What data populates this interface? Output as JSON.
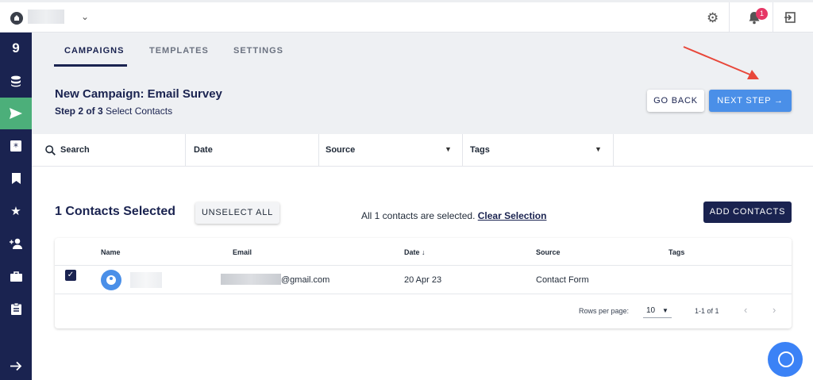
{
  "topbar": {
    "notification_count": "1"
  },
  "icons": {
    "home": "home-icon",
    "gear": "⚙",
    "bell": "🔔",
    "exit": "⇥"
  },
  "sidebar": {
    "items": [
      {
        "name": "logo",
        "glyph": "9"
      },
      {
        "name": "database",
        "glyph": "≋"
      },
      {
        "name": "send",
        "glyph": "➤",
        "active": true
      },
      {
        "name": "asterisk",
        "glyph": "✱"
      },
      {
        "name": "bookmark",
        "glyph": "▮"
      },
      {
        "name": "star",
        "glyph": "★"
      },
      {
        "name": "add-user",
        "glyph": "✚"
      },
      {
        "name": "briefcase",
        "glyph": "▬"
      },
      {
        "name": "clipboard",
        "glyph": "▤"
      },
      {
        "name": "expand",
        "glyph": "→"
      }
    ]
  },
  "tabs": [
    "CAMPAIGNS",
    "TEMPLATES",
    "SETTINGS"
  ],
  "header": {
    "title": "New Campaign: Email Survey",
    "step_bold": "Step 2 of 3",
    "step_text": " Select Contacts",
    "go_back_label": "GO BACK",
    "next_step_label": "NEXT STEP →"
  },
  "filters": {
    "search_label": "Search",
    "date_label": "Date",
    "source_label": "Source",
    "tags_label": "Tags"
  },
  "selection": {
    "title": "1 Contacts Selected",
    "unselect_label": "UNSELECT ALL",
    "info_text": "All 1 contacts are selected. ",
    "clear_label": "Clear Selection",
    "add_contacts_label": "ADD CONTACTS"
  },
  "table": {
    "headers": {
      "name": "Name",
      "email": "Email",
      "date": "Date ↓",
      "source": "Source",
      "tags": "Tags"
    },
    "rows": [
      {
        "email_suffix": "@gmail.com",
        "date": "20 Apr 23",
        "source": "Contact Form",
        "tags": ""
      }
    ],
    "pagination": {
      "rows_per_page_label": "Rows per page:",
      "rows_per_page_value": "10",
      "range": "1-1 of 1"
    }
  },
  "colors": {
    "brand_navy": "#1a2350",
    "accent_blue": "#4a8fe8",
    "active_green": "#4caf7a",
    "badge_pink": "#e63766",
    "annotation_red": "#e8473a"
  }
}
